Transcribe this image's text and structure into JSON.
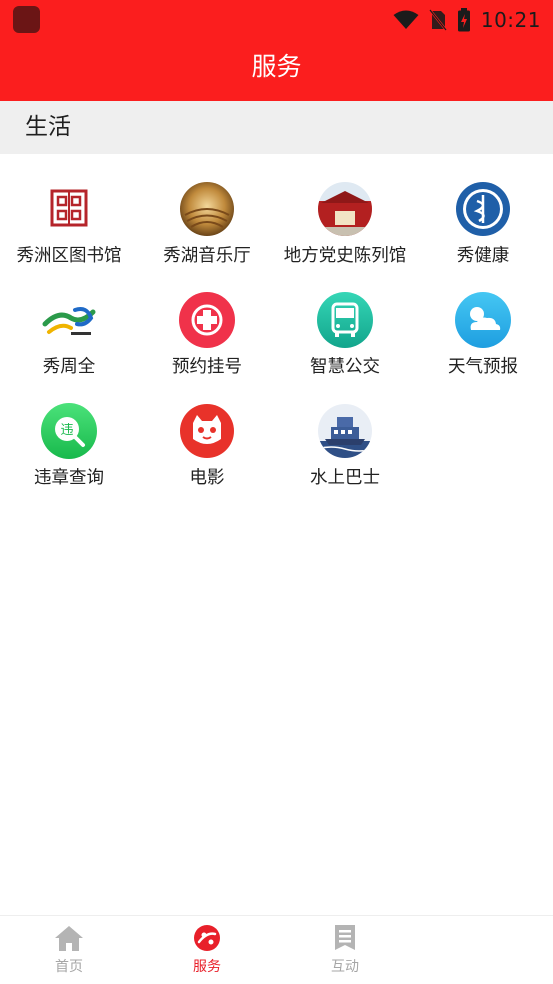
{
  "status_bar": {
    "time": "10:21"
  },
  "header": {
    "title": "服务"
  },
  "section": {
    "label": "生活"
  },
  "services": [
    {
      "label": "秀洲区图书馆",
      "icon": "library-seal-icon"
    },
    {
      "label": "秀湖音乐厅",
      "icon": "concert-hall-icon"
    },
    {
      "label": "地方党史陈列馆",
      "icon": "museum-building-icon"
    },
    {
      "label": "秀健康",
      "icon": "health-badge-icon"
    },
    {
      "label": "秀周全",
      "icon": "xiu-zhouquan-logo-icon"
    },
    {
      "label": "预约挂号",
      "icon": "medical-cross-icon"
    },
    {
      "label": "智慧公交",
      "icon": "bus-icon"
    },
    {
      "label": "天气预报",
      "icon": "weather-icon"
    },
    {
      "label": "违章查询",
      "icon": "violation-search-icon"
    },
    {
      "label": "电影",
      "icon": "movie-cat-icon"
    },
    {
      "label": "水上巴士",
      "icon": "water-bus-icon"
    }
  ],
  "bottom_nav": [
    {
      "label": "首页",
      "icon": "home-icon",
      "active": false
    },
    {
      "label": "服务",
      "icon": "services-icon",
      "active": true
    },
    {
      "label": "互动",
      "icon": "interaction-icon",
      "active": false
    }
  ],
  "colors": {
    "brand_red": "#fb1e1e",
    "active_tab": "#e8202a",
    "inactive_tab": "#a6a6a6"
  }
}
